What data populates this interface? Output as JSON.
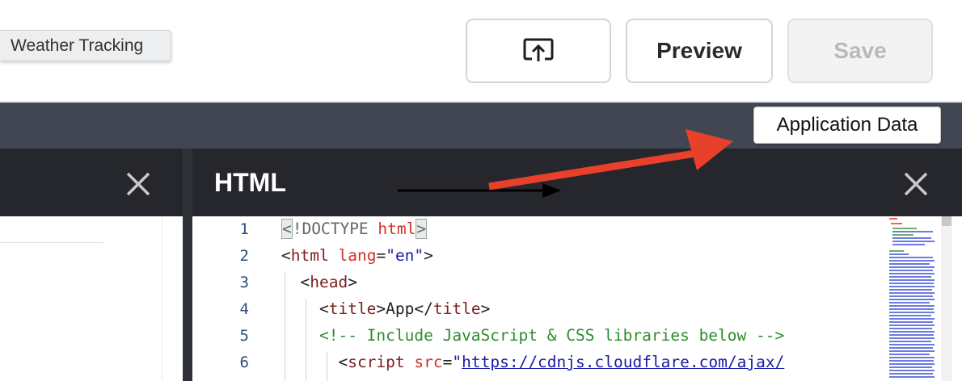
{
  "app": {
    "name": "Weather Tracking"
  },
  "toolbar": {
    "share_icon": "share-upload-icon",
    "preview_label": "Preview",
    "save_label": "Save"
  },
  "header": {
    "application_data_label": "Application Data"
  },
  "panels": {
    "html_title": "HTML",
    "close_icon": "close-icon"
  },
  "editor": {
    "line_numbers": [
      "1",
      "2",
      "3",
      "4",
      "5",
      "6"
    ],
    "lines": [
      "<!DOCTYPE html>",
      "<html lang=\"en\">",
      "  <head>",
      "    <title>App</title>",
      "    <!-- Include JavaScript & CSS libraries below -->",
      "      <script src=\"https://cdnjs.cloudflare.com/ajax/"
    ]
  },
  "colors": {
    "band": "#414652",
    "panel_header": "#25272c",
    "annotation_red": "#e8402a",
    "annotation_black": "#000000"
  }
}
